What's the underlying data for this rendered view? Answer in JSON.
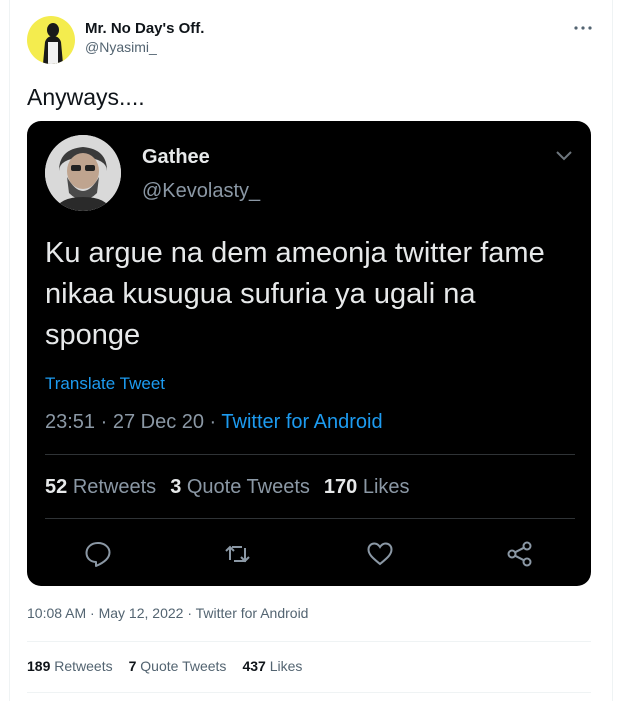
{
  "author": {
    "name": "Mr. No Day's Off.",
    "handle": "@Nyasimi_"
  },
  "tweet": {
    "text": "Anyways....",
    "timestamp": "10:08 AM · May 12, 2022",
    "separator": " · ",
    "source": "Twitter for Android",
    "stats": {
      "retweets_count": "189",
      "retweets_label": "Retweets",
      "quotes_count": "7",
      "quotes_label": "Quote Tweets",
      "likes_count": "437",
      "likes_label": "Likes"
    }
  },
  "embedded": {
    "name": "Gathee",
    "handle": "@Kevolasty_",
    "body": "Ku argue na dem ameonja twitter fame nikaa kusugua sufuria ya ugali na sponge",
    "translate_label": "Translate Tweet",
    "timestamp": "23:51 · 27 Dec 20",
    "separator": " · ",
    "source": "Twitter for Android",
    "stats": {
      "retweets_count": "52",
      "retweets_label": "Retweets",
      "quotes_count": "3",
      "quotes_label": "Quote Tweets",
      "likes_count": "170",
      "likes_label": "Likes"
    },
    "actions": [
      "reply-icon",
      "retweet-icon",
      "like-icon",
      "share-icon"
    ]
  },
  "colors": {
    "accent": "#1d9bf0",
    "avatar_bg": "#f4ec4e",
    "dark_bg": "#000000"
  }
}
